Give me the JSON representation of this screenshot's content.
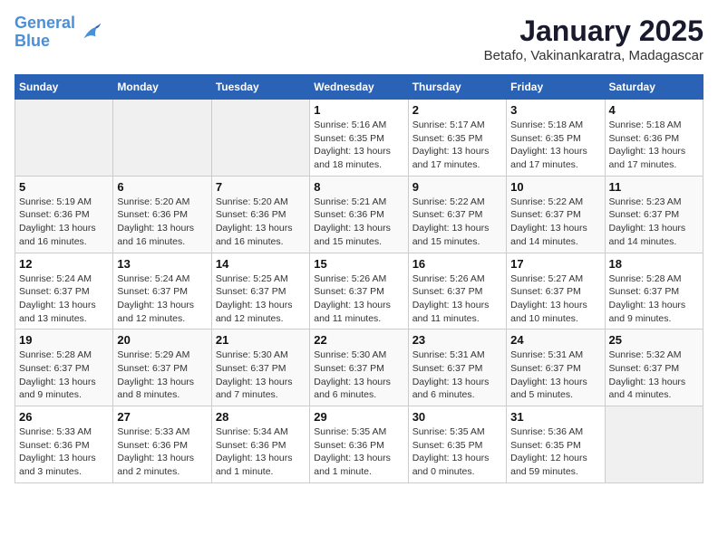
{
  "logo": {
    "line1": "General",
    "line2": "Blue"
  },
  "title": "January 2025",
  "subtitle": "Betafo, Vakinankaratra, Madagascar",
  "days_of_week": [
    "Sunday",
    "Monday",
    "Tuesday",
    "Wednesday",
    "Thursday",
    "Friday",
    "Saturday"
  ],
  "weeks": [
    [
      {
        "day": "",
        "info": ""
      },
      {
        "day": "",
        "info": ""
      },
      {
        "day": "",
        "info": ""
      },
      {
        "day": "1",
        "info": "Sunrise: 5:16 AM\nSunset: 6:35 PM\nDaylight: 13 hours\nand 18 minutes."
      },
      {
        "day": "2",
        "info": "Sunrise: 5:17 AM\nSunset: 6:35 PM\nDaylight: 13 hours\nand 17 minutes."
      },
      {
        "day": "3",
        "info": "Sunrise: 5:18 AM\nSunset: 6:35 PM\nDaylight: 13 hours\nand 17 minutes."
      },
      {
        "day": "4",
        "info": "Sunrise: 5:18 AM\nSunset: 6:36 PM\nDaylight: 13 hours\nand 17 minutes."
      }
    ],
    [
      {
        "day": "5",
        "info": "Sunrise: 5:19 AM\nSunset: 6:36 PM\nDaylight: 13 hours\nand 16 minutes."
      },
      {
        "day": "6",
        "info": "Sunrise: 5:20 AM\nSunset: 6:36 PM\nDaylight: 13 hours\nand 16 minutes."
      },
      {
        "day": "7",
        "info": "Sunrise: 5:20 AM\nSunset: 6:36 PM\nDaylight: 13 hours\nand 16 minutes."
      },
      {
        "day": "8",
        "info": "Sunrise: 5:21 AM\nSunset: 6:36 PM\nDaylight: 13 hours\nand 15 minutes."
      },
      {
        "day": "9",
        "info": "Sunrise: 5:22 AM\nSunset: 6:37 PM\nDaylight: 13 hours\nand 15 minutes."
      },
      {
        "day": "10",
        "info": "Sunrise: 5:22 AM\nSunset: 6:37 PM\nDaylight: 13 hours\nand 14 minutes."
      },
      {
        "day": "11",
        "info": "Sunrise: 5:23 AM\nSunset: 6:37 PM\nDaylight: 13 hours\nand 14 minutes."
      }
    ],
    [
      {
        "day": "12",
        "info": "Sunrise: 5:24 AM\nSunset: 6:37 PM\nDaylight: 13 hours\nand 13 minutes."
      },
      {
        "day": "13",
        "info": "Sunrise: 5:24 AM\nSunset: 6:37 PM\nDaylight: 13 hours\nand 12 minutes."
      },
      {
        "day": "14",
        "info": "Sunrise: 5:25 AM\nSunset: 6:37 PM\nDaylight: 13 hours\nand 12 minutes."
      },
      {
        "day": "15",
        "info": "Sunrise: 5:26 AM\nSunset: 6:37 PM\nDaylight: 13 hours\nand 11 minutes."
      },
      {
        "day": "16",
        "info": "Sunrise: 5:26 AM\nSunset: 6:37 PM\nDaylight: 13 hours\nand 11 minutes."
      },
      {
        "day": "17",
        "info": "Sunrise: 5:27 AM\nSunset: 6:37 PM\nDaylight: 13 hours\nand 10 minutes."
      },
      {
        "day": "18",
        "info": "Sunrise: 5:28 AM\nSunset: 6:37 PM\nDaylight: 13 hours\nand 9 minutes."
      }
    ],
    [
      {
        "day": "19",
        "info": "Sunrise: 5:28 AM\nSunset: 6:37 PM\nDaylight: 13 hours\nand 9 minutes."
      },
      {
        "day": "20",
        "info": "Sunrise: 5:29 AM\nSunset: 6:37 PM\nDaylight: 13 hours\nand 8 minutes."
      },
      {
        "day": "21",
        "info": "Sunrise: 5:30 AM\nSunset: 6:37 PM\nDaylight: 13 hours\nand 7 minutes."
      },
      {
        "day": "22",
        "info": "Sunrise: 5:30 AM\nSunset: 6:37 PM\nDaylight: 13 hours\nand 6 minutes."
      },
      {
        "day": "23",
        "info": "Sunrise: 5:31 AM\nSunset: 6:37 PM\nDaylight: 13 hours\nand 6 minutes."
      },
      {
        "day": "24",
        "info": "Sunrise: 5:31 AM\nSunset: 6:37 PM\nDaylight: 13 hours\nand 5 minutes."
      },
      {
        "day": "25",
        "info": "Sunrise: 5:32 AM\nSunset: 6:37 PM\nDaylight: 13 hours\nand 4 minutes."
      }
    ],
    [
      {
        "day": "26",
        "info": "Sunrise: 5:33 AM\nSunset: 6:36 PM\nDaylight: 13 hours\nand 3 minutes."
      },
      {
        "day": "27",
        "info": "Sunrise: 5:33 AM\nSunset: 6:36 PM\nDaylight: 13 hours\nand 2 minutes."
      },
      {
        "day": "28",
        "info": "Sunrise: 5:34 AM\nSunset: 6:36 PM\nDaylight: 13 hours\nand 1 minute."
      },
      {
        "day": "29",
        "info": "Sunrise: 5:35 AM\nSunset: 6:36 PM\nDaylight: 13 hours\nand 1 minute."
      },
      {
        "day": "30",
        "info": "Sunrise: 5:35 AM\nSunset: 6:35 PM\nDaylight: 13 hours\nand 0 minutes."
      },
      {
        "day": "31",
        "info": "Sunrise: 5:36 AM\nSunset: 6:35 PM\nDaylight: 12 hours\nand 59 minutes."
      },
      {
        "day": "",
        "info": ""
      }
    ]
  ]
}
